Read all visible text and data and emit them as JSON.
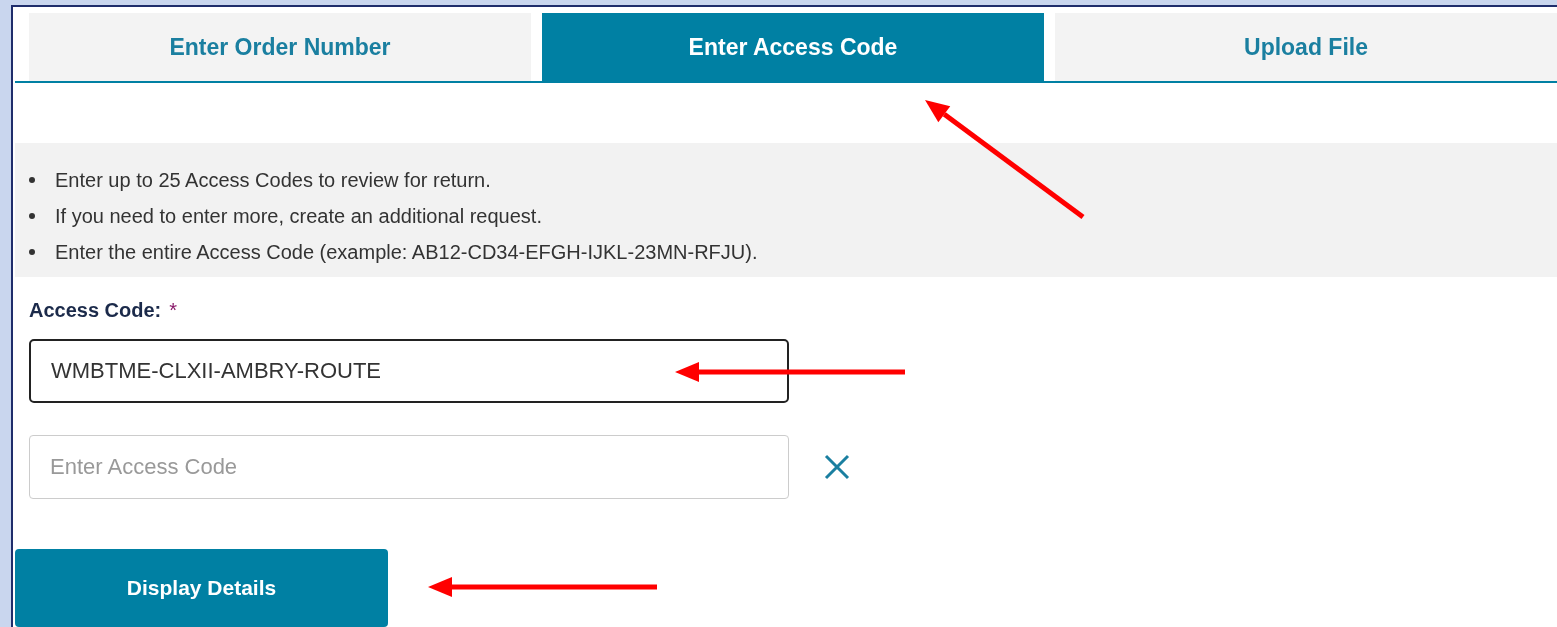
{
  "tabs": [
    {
      "label": "Enter Order Number",
      "selected": false
    },
    {
      "label": "Enter Access Code",
      "selected": true
    },
    {
      "label": "Upload File",
      "selected": false
    }
  ],
  "instructions": [
    "Enter up to 25 Access Codes to review for return.",
    "If you need to enter more, create an additional request.",
    "Enter the entire Access Code (example: AB12-CD34-EFGH-IJKL-23MN-RFJU)."
  ],
  "field_label": {
    "text": "Access Code:",
    "required_mark": "*"
  },
  "fields": [
    {
      "value": "WMBTME-CLXII-AMBRY-ROUTE",
      "focused": true,
      "removable": false
    },
    {
      "placeholder": "Enter Access Code",
      "focused": false,
      "removable": true
    }
  ],
  "submit_button": "Display Details"
}
